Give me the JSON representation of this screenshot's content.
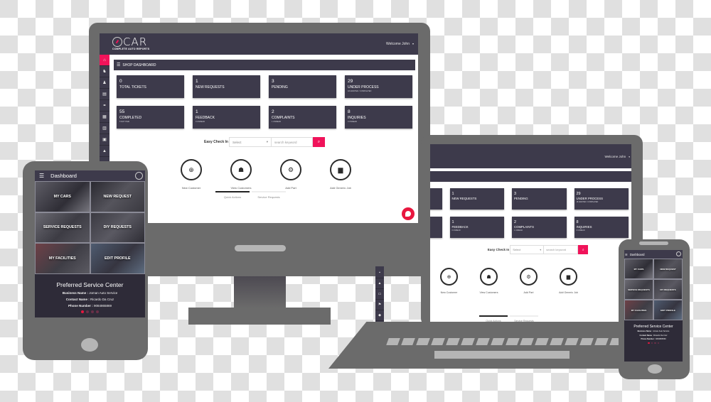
{
  "dashboard": {
    "logo": {
      "text": "CAR",
      "subtitle": "COMPLETE AUTO REPORTS"
    },
    "user_menu": {
      "label": "Welcome John",
      "caret": "▾"
    },
    "section_title": "SHOP DASHBOARD",
    "sidebar_icons": [
      {
        "name": "home-icon",
        "glyph": "⌂",
        "active": true
      },
      {
        "name": "users-icon",
        "glyph": "♞",
        "active": false
      },
      {
        "name": "user-icon",
        "glyph": "♟",
        "active": false
      },
      {
        "name": "document-icon",
        "glyph": "▤",
        "active": false
      },
      {
        "name": "handshake-icon",
        "glyph": "⚭",
        "active": false
      },
      {
        "name": "notes-icon",
        "glyph": "▦",
        "active": false
      },
      {
        "name": "chart-icon",
        "glyph": "▥",
        "active": false
      },
      {
        "name": "calendar-icon",
        "glyph": "▣",
        "active": false
      },
      {
        "name": "warning-icon",
        "glyph": "▲",
        "active": false
      }
    ],
    "laptop_sidebar_icons": [
      {
        "name": "document-icon",
        "glyph": "▪"
      },
      {
        "name": "warning-icon",
        "glyph": "▲"
      },
      {
        "name": "monitor-icon",
        "glyph": "▭"
      },
      {
        "name": "flag-icon",
        "glyph": "⚑"
      },
      {
        "name": "tag-icon",
        "glyph": "◆"
      }
    ],
    "cards": [
      {
        "value": "0",
        "label": "TOTAL TICKETS",
        "sub": ""
      },
      {
        "value": "1",
        "label": "NEW REQUESTS",
        "sub": ""
      },
      {
        "value": "3",
        "label": "PENDING",
        "sub": ""
      },
      {
        "value": "29",
        "label": "UNDER PROCESS",
        "sub": "18 AWAITED / COMPLETED"
      },
      {
        "value": "55",
        "label": "COMPLETED",
        "sub": "5 NOT PAID"
      },
      {
        "value": "1",
        "label": "FEEDBACK",
        "sub": "0 UNREAD"
      },
      {
        "value": "2",
        "label": "COMPLAINTS",
        "sub": "1 UNREAD"
      },
      {
        "value": "8",
        "label": "INQUIRIES",
        "sub": "0 UNREAD"
      }
    ],
    "easy_checkin": {
      "label": "Easy Check In",
      "select_value": "Select",
      "search_placeholder": "search keyword",
      "search_icon": "⌕"
    },
    "quick_actions": [
      {
        "label": "New Customer",
        "icon": "plus-circle-icon",
        "glyph": "⊕"
      },
      {
        "label": "View Customers",
        "icon": "users-group-icon",
        "glyph": "☗"
      },
      {
        "label": "Add Part",
        "icon": "cogs-icon",
        "glyph": "⚙"
      },
      {
        "label": "Add Generic Job",
        "icon": "briefcase-icon",
        "glyph": "▆"
      }
    ],
    "tabs": [
      {
        "label": "Quick Actions",
        "active": true
      },
      {
        "label": "Service Requests",
        "active": false
      }
    ]
  },
  "mobile_app": {
    "title": "Dashboard",
    "menu_icon": "☰",
    "tiles": [
      {
        "label": "MY CARS"
      },
      {
        "label": "NEW REQUEST"
      },
      {
        "label": "SERVICE REQUESTS"
      },
      {
        "label": "DIY REQUESTS"
      },
      {
        "label": "MY FACILITIES"
      },
      {
        "label": "EDIT PROFILE"
      }
    ],
    "preferred": {
      "title": "Preferred Service Center",
      "business_label": "Business Name :",
      "business_value": "Joman Auto Service",
      "contact_label": "Contact Name :",
      "contact_value": "Ricardo Da Cruz",
      "phone_label": "Phone Number :",
      "phone_value": "9084865869"
    },
    "carousel": {
      "count": 4,
      "active_index": 0
    }
  },
  "colors": {
    "accent": "#f0135a",
    "panel": "#3d3a4b",
    "device": "#6b6b6b"
  }
}
